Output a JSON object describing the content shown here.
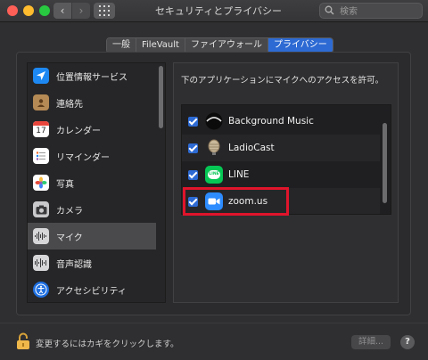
{
  "window": {
    "title": "セキュリティとプライバシー",
    "back_glyph": "‹",
    "forward_glyph": "›"
  },
  "search": {
    "placeholder": "検索"
  },
  "tabs": [
    {
      "label": "一般",
      "active": false
    },
    {
      "label": "FileVault",
      "active": false
    },
    {
      "label": "ファイアウォール",
      "active": false
    },
    {
      "label": "プライバシー",
      "active": true
    }
  ],
  "sidebar": {
    "items": [
      {
        "label": "位置情報サービス",
        "icon": "location-arrow-icon",
        "selected": false
      },
      {
        "label": "連絡先",
        "icon": "contacts-book-icon",
        "selected": false
      },
      {
        "label": "カレンダー",
        "icon": "calendar-icon",
        "selected": false,
        "icon_text": "17"
      },
      {
        "label": "リマインダー",
        "icon": "reminders-list-icon",
        "selected": false
      },
      {
        "label": "写真",
        "icon": "photos-flower-icon",
        "selected": false
      },
      {
        "label": "カメラ",
        "icon": "camera-icon",
        "selected": false
      },
      {
        "label": "マイク",
        "icon": "microphone-waveform-icon",
        "selected": true
      },
      {
        "label": "音声認識",
        "icon": "speech-waveform-icon",
        "selected": false
      },
      {
        "label": "アクセシビリティ",
        "icon": "accessibility-icon",
        "selected": false
      }
    ]
  },
  "main": {
    "allow_label": "下のアプリケーションにマイクへのアクセスを許可。",
    "apps": [
      {
        "name": "Background Music",
        "checked": true,
        "icon": "background-music-icon"
      },
      {
        "name": "LadioCast",
        "checked": true,
        "icon": "ladiocast-microphone-icon"
      },
      {
        "name": "LINE",
        "checked": true,
        "icon": "line-chat-icon",
        "icon_text": "LINE"
      },
      {
        "name": "zoom.us",
        "checked": true,
        "icon": "zoom-camera-icon",
        "highlighted": true
      }
    ]
  },
  "footer": {
    "lock_text": "変更するにはカギをクリックします。",
    "advanced_label": "詳細...",
    "help_label": "?"
  },
  "colors": {
    "accent": "#2d6ad3",
    "highlight_border": "#e0142b",
    "background": "#2f2f31"
  }
}
